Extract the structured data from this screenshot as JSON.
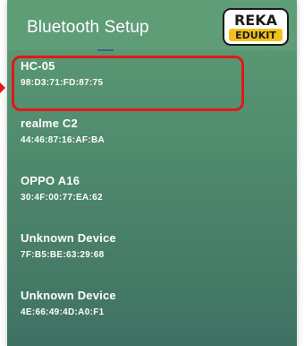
{
  "header": {
    "title": "Bluetooth Setup",
    "logo": {
      "line1": "REKA",
      "line2": "EDUKIT"
    }
  },
  "devices": [
    {
      "name": "HC-05",
      "mac": "98:D3:71:FD:87:75",
      "highlighted": true
    },
    {
      "name": "realme C2",
      "mac": "44:46:87:16:AF:BA"
    },
    {
      "name": "OPPO A16",
      "mac": "30:4F:00:77:EA:62"
    },
    {
      "name": "Unknown Device",
      "mac": "7F:B5:BE:63:29:68"
    },
    {
      "name": "Unknown Device",
      "mac": "4E:66:49:4D:A0:F1"
    }
  ],
  "colors": {
    "appbar": "#5e9d76",
    "highlight": "#e2171a",
    "logo_fill": "#ffffff",
    "logo_text": "#1b1b1b",
    "logo_accent": "#f2c21b"
  }
}
